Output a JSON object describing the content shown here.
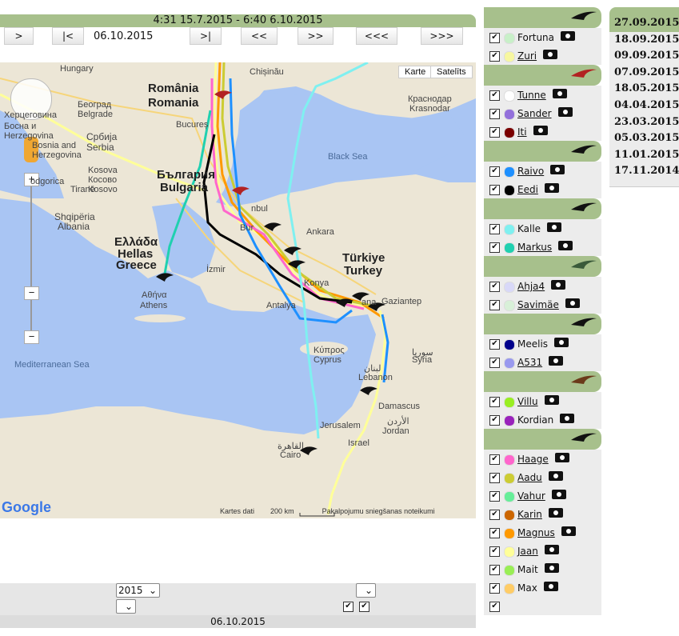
{
  "header": {
    "time_range": "4:31 15.7.2015 - 6:40 6.10.2015"
  },
  "nav": {
    "buttons": [
      ">",
      "|<",
      ">|",
      "<<",
      ">>",
      "<<<",
      ">>>"
    ],
    "current_date": "06.10.2015"
  },
  "map": {
    "maptype_map": "Karte",
    "maptype_satellite": "Satelīts",
    "labels": {
      "hungary": "Hungary",
      "chisinau": "Chișinău",
      "romania1": "România",
      "romania2": "Romania",
      "beograd": "Београд",
      "belgrade": "Belgrade",
      "bosna": "Босна и",
      "herceg": "Херцеговина",
      "bosnia": "Bosnia and",
      "herzegovina": "Herzegovina",
      "herzeg2": "Herzegovina",
      "srbija": "Србија",
      "serbia": "Serbia",
      "bucuresti": "Bucureș",
      "krasnodar_ru": "Краснодар",
      "krasnodar": "Krasnodar",
      "kosova": "Kosova",
      "kosovo": "Косово",
      "kosovo2": "Kosovo",
      "bulgaria_bg": "България",
      "bulgaria": "Bulgaria",
      "podgorica": "odgorica",
      "tirane": "Tiranë",
      "shqiperia": "Shqipëria",
      "albania": "Albania",
      "ellada": "Ελλάδα",
      "hellas": "Hellas",
      "greece": "Greece",
      "istanbul": "nbul",
      "bursa": "Bur",
      "ankara": "Ankara",
      "izmir": "İzmir",
      "turkiye": "Türkiye",
      "turkey": "Turkey",
      "konya": "Konya",
      "athina": "Αθήνα",
      "athens": "Athens",
      "antalya": "Antalya",
      "adana": "ana",
      "gaziantep": "Gaziantep",
      "black_sea": "Black Sea",
      "med_sea": "Mediterranean Sea",
      "kypros": "Κύπρος",
      "cyprus": "Cyprus",
      "suriya": "سوريا",
      "syria": "Syria",
      "lubnan": "لبنان",
      "lebanon": "Lebanon",
      "damascus": "Damascus",
      "jerusalem": "Jerusalem",
      "israel": "Israel",
      "jordan_ar": "الأردن",
      "jordan": "Jordan",
      "cairo_ar": "القاهرة",
      "cairo": "Cairo"
    },
    "google_logo": "Google",
    "attribution_data": "Kartes dati",
    "scale": "200 km",
    "terms": "Pakalpojumu sniegšanas noteikumi"
  },
  "bottom": {
    "year_select": "2015",
    "footer_date": "06.10.2015"
  },
  "legend": {
    "groups": [
      {
        "color": "#111111",
        "birds": [
          {
            "name": "Fortuna",
            "color": "#c8f0c8",
            "link": false
          },
          {
            "name": "Zuri",
            "color": "#f7f7a0",
            "link": true
          }
        ]
      },
      {
        "color": "#b22222",
        "birds": [
          {
            "name": "Tunne",
            "color": "#ffffff",
            "link": true
          },
          {
            "name": "Sander",
            "color": "#9370db",
            "link": true
          },
          {
            "name": "Iti",
            "color": "#7a0000",
            "link": true
          }
        ]
      },
      {
        "color": "#111111",
        "birds": [
          {
            "name": "Raivo",
            "color": "#1e90ff",
            "link": true
          },
          {
            "name": "Eedi",
            "color": "#000000",
            "link": true
          }
        ]
      },
      {
        "color": "#111111",
        "birds": [
          {
            "name": "Kalle",
            "color": "#7ff0f0",
            "link": false
          },
          {
            "name": "Markus",
            "color": "#20d0b0",
            "link": true
          }
        ]
      },
      {
        "color": "#3a5a3a",
        "birds": [
          {
            "name": "Ahja4",
            "color": "#d8d8f8",
            "link": true
          },
          {
            "name": "Savimäe",
            "color": "#d8f0d8",
            "link": true
          }
        ]
      },
      {
        "color": "#111111",
        "birds": [
          {
            "name": "Meelis",
            "color": "#00008b",
            "link": false
          },
          {
            "name": "A531",
            "color": "#9999ee",
            "link": true
          }
        ]
      },
      {
        "color": "#6b3a1a",
        "birds": [
          {
            "name": "Villu",
            "color": "#99ee22",
            "link": true
          },
          {
            "name": "Kordian",
            "color": "#9922bb",
            "link": false
          }
        ]
      },
      {
        "color": "#111111",
        "birds": [
          {
            "name": "Haage",
            "color": "#ff66cc",
            "link": true
          },
          {
            "name": "Aadu",
            "color": "#cccc33",
            "link": true
          },
          {
            "name": "Vahur",
            "color": "#66ee99",
            "link": true
          },
          {
            "name": "Karin",
            "color": "#cc6600",
            "link": true
          },
          {
            "name": "Magnus",
            "color": "#ff9900",
            "link": true
          },
          {
            "name": "Jaan",
            "color": "#ffff99",
            "link": true
          },
          {
            "name": "Mait",
            "color": "#99ee55",
            "link": false
          },
          {
            "name": "Max",
            "color": "#ffcc66",
            "link": false
          }
        ]
      }
    ]
  },
  "dates": [
    "27.09.2015",
    "18.09.2015",
    "09.09.2015",
    "07.09.2015",
    "18.05.2015",
    "04.04.2015",
    "23.03.2015",
    "05.03.2015",
    "11.01.2015",
    "17.11.2014"
  ]
}
